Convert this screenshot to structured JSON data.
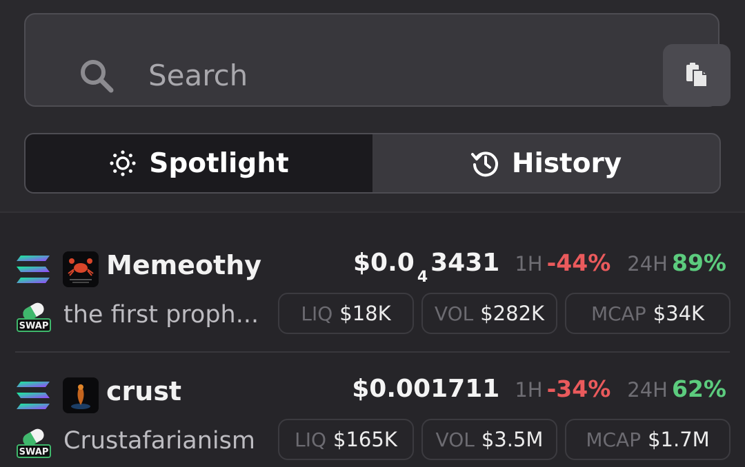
{
  "search": {
    "placeholder": "Search"
  },
  "tabs": [
    {
      "label": "Spotlight",
      "icon": "sun-icon",
      "active": true
    },
    {
      "label": "History",
      "icon": "history-icon",
      "active": false
    }
  ],
  "tokens": [
    {
      "name": "Memeothy",
      "description": "the first proph...",
      "price": {
        "prefix": "$0.0",
        "sub": "4",
        "rest": "3431"
      },
      "h1_label": "1H",
      "h1": "-44%",
      "h24_label": "24H",
      "h24": "89%",
      "liq_label": "LIQ",
      "liq": "$18K",
      "vol_label": "VOL",
      "vol": "$282K",
      "mcap_label": "MCAP",
      "mcap": "$34K",
      "chain_icon": "solana-icon",
      "dex_icon": "swap-pill-icon",
      "swap_text": "SWAP"
    },
    {
      "name": "crust",
      "description": "Crustafarianism",
      "price": {
        "prefix": "$0.001711",
        "sub": "",
        "rest": ""
      },
      "h1_label": "1H",
      "h1": "-34%",
      "h24_label": "24H",
      "h24": "62%",
      "liq_label": "LIQ",
      "liq": "$165K",
      "vol_label": "VOL",
      "vol": "$3.5M",
      "mcap_label": "MCAP",
      "mcap": "$1.7M",
      "chain_icon": "solana-icon",
      "dex_icon": "swap-pill-icon",
      "swap_text": "SWAP"
    }
  ],
  "colors": {
    "background": "#262529",
    "negative": "#ea5a5c",
    "positive": "#5ccc7e",
    "accent_purple": "#9945ff",
    "accent_teal": "#14f195"
  }
}
